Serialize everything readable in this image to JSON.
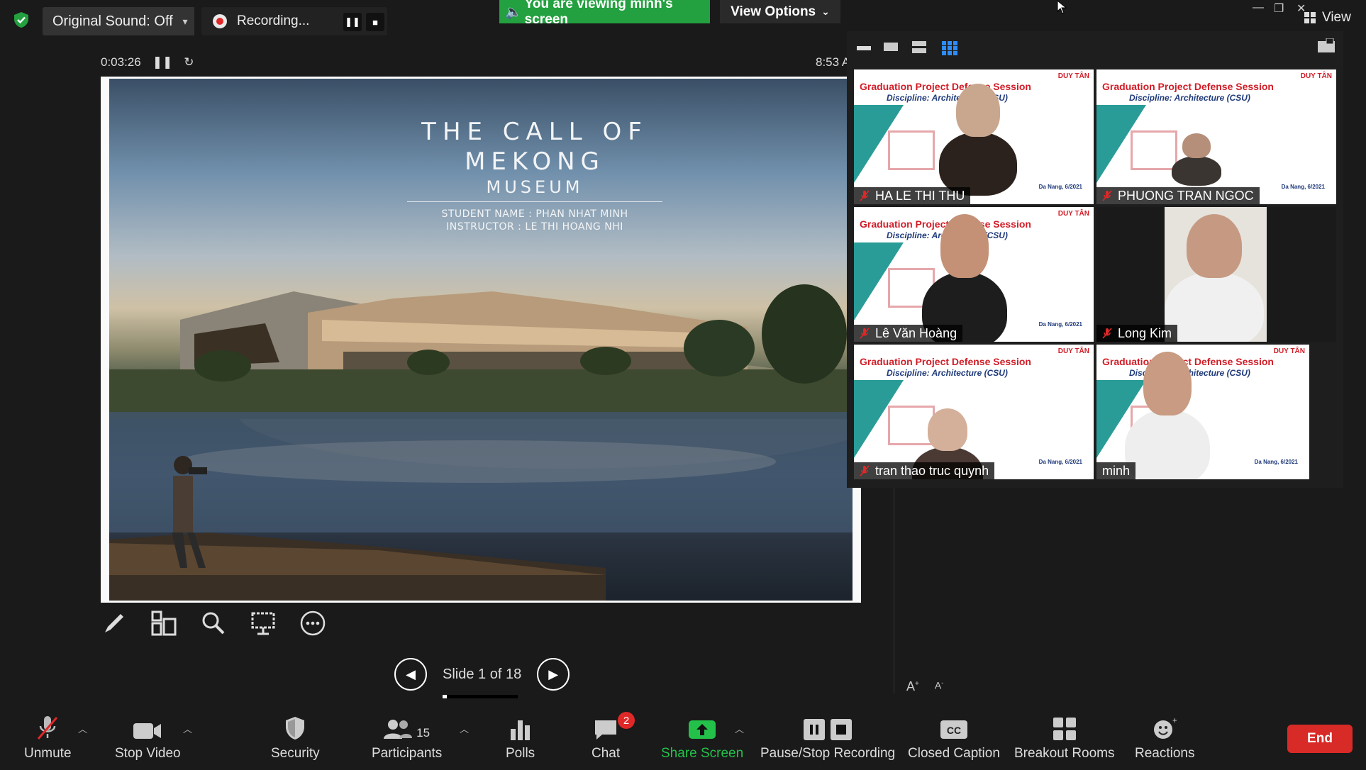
{
  "topbar": {
    "original_sound": "Original Sound: Off",
    "recording": "Recording...",
    "viewing_banner": "You are viewing minh's screen",
    "view_options": "View Options",
    "view": "View"
  },
  "share": {
    "elapsed": "0:03:26",
    "clock": "8:53 A",
    "slide_label": "Slide 1 of 18",
    "slide_progress": 0.0556,
    "slide": {
      "title_line1": "THE CALL OF",
      "title_line2": "MEKONG",
      "title_line3": "MUSEUM",
      "student": "STUDENT NAME : PHAN NHAT MINH",
      "instructor": "INSTRUCTOR : LE THI HOANG NHI"
    }
  },
  "gallery": {
    "slide_title": "Graduation Project Defense Session",
    "discipline": "Discipline: Architecture (CSU)",
    "logo": "DUY TÂN",
    "date": "Da Nang, 6/2021",
    "participants": [
      {
        "name": "HA LE THI THU",
        "muted": true
      },
      {
        "name": "PHUONG TRAN NGOC",
        "muted": true
      },
      {
        "name": "Lê Văn Hoàng",
        "muted": true
      },
      {
        "name": "Long Kim",
        "muted": true
      },
      {
        "name": "tran thao truc quynh",
        "muted": true
      },
      {
        "name": "minh",
        "muted": false
      }
    ]
  },
  "toolbar": {
    "unmute": "Unmute",
    "stop_video": "Stop Video",
    "security": "Security",
    "participants": "Participants",
    "participants_count": "15",
    "polls": "Polls",
    "chat": "Chat",
    "chat_badge": "2",
    "share_screen": "Share Screen",
    "pause_stop_recording": "Pause/Stop Recording",
    "closed_caption": "Closed Caption",
    "breakout_rooms": "Breakout Rooms",
    "reactions": "Reactions",
    "end": "End"
  },
  "colors": {
    "share_green": "#23a03f",
    "end_red": "#d82a27",
    "badge_red": "#e02828",
    "teal": "#2a9c98"
  }
}
